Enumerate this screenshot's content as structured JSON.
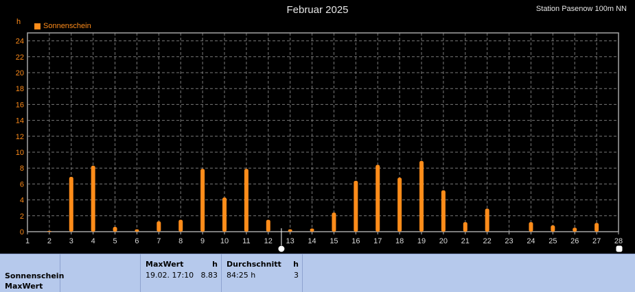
{
  "header": {
    "title": "Februar 2025",
    "station": "Station Pasenow 100m NN",
    "unit": "h"
  },
  "colors": {
    "series": "#ff8c1a",
    "background": "#000000",
    "panel": "#b6c9ec"
  },
  "chart_data": {
    "type": "bar",
    "title": "Februar 2025",
    "ylabel": "h",
    "ylim": [
      0,
      25
    ],
    "yticks": [
      0,
      2,
      4,
      6,
      8,
      10,
      12,
      14,
      16,
      18,
      20,
      22,
      24
    ],
    "grid": true,
    "legend": "top-left",
    "categories": [
      "1",
      "2",
      "3",
      "4",
      "5",
      "6",
      "7",
      "8",
      "9",
      "10",
      "11",
      "12",
      "13",
      "14",
      "15",
      "16",
      "17",
      "18",
      "19",
      "20",
      "21",
      "22",
      "23",
      "24",
      "25",
      "26",
      "27",
      "28"
    ],
    "series": [
      {
        "name": "Sonnenschein",
        "color": "#ff8c1a",
        "values": [
          0,
          0.1,
          6.9,
          8.3,
          0.6,
          0.3,
          1.3,
          1.5,
          7.9,
          4.3,
          7.9,
          1.5,
          0.3,
          0.4,
          2.4,
          6.4,
          8.4,
          6.8,
          8.9,
          5.2,
          1.2,
          2.9,
          0,
          1.2,
          0.8,
          0.5,
          1.1,
          null
        ]
      }
    ]
  },
  "stats": {
    "row_labels": [
      "Sonnenschein",
      "MaxWert"
    ],
    "max_header": "MaxWert",
    "max_unit": "h",
    "max_time": "19.02.  17:10",
    "max_value": "8.83",
    "avg_header": "Durchschnitt",
    "avg_unit": "h",
    "avg_total": "84:25 h",
    "avg_value": "3"
  }
}
